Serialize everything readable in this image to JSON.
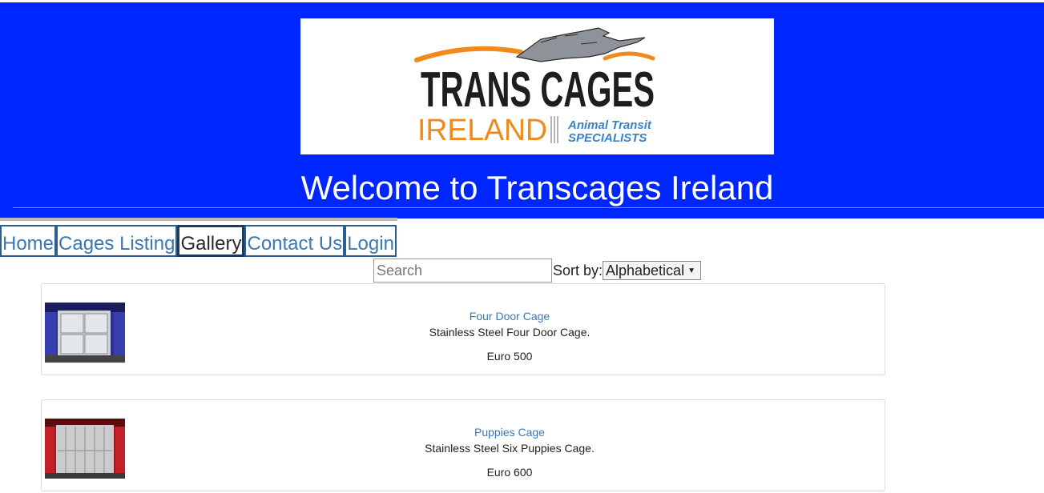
{
  "header": {
    "background_color": "#0026ff",
    "welcome_title": "Welcome to Transcages Ireland",
    "logo": {
      "word_trans_cages": "TRANS CAGES",
      "word_ireland": "IRELAND",
      "tagline_line1": "Animal Transit",
      "tagline_line2": "SPECIALISTS",
      "icon": "greyhound-logo-icon"
    }
  },
  "nav": {
    "items": [
      {
        "label": "Home",
        "active": false
      },
      {
        "label": "Cages Listing",
        "active": false
      },
      {
        "label": "Gallery",
        "active": true
      },
      {
        "label": "Contact Us",
        "active": false
      },
      {
        "label": "Login",
        "active": false
      }
    ]
  },
  "controls": {
    "search_placeholder": "Search",
    "search_value": "",
    "sort_label": "Sort by:",
    "sort_selected": "Alphabetical",
    "sort_arrow_icon": "triangle-down-icon"
  },
  "products": [
    {
      "title": "Four Door Cage",
      "description": "Stainless Steel Four Door Cage.",
      "price": "Euro 500"
    },
    {
      "title": "Puppies Cage",
      "description": "Stainless Steel Six Puppies Cage.",
      "price": "Euro 600"
    }
  ]
}
